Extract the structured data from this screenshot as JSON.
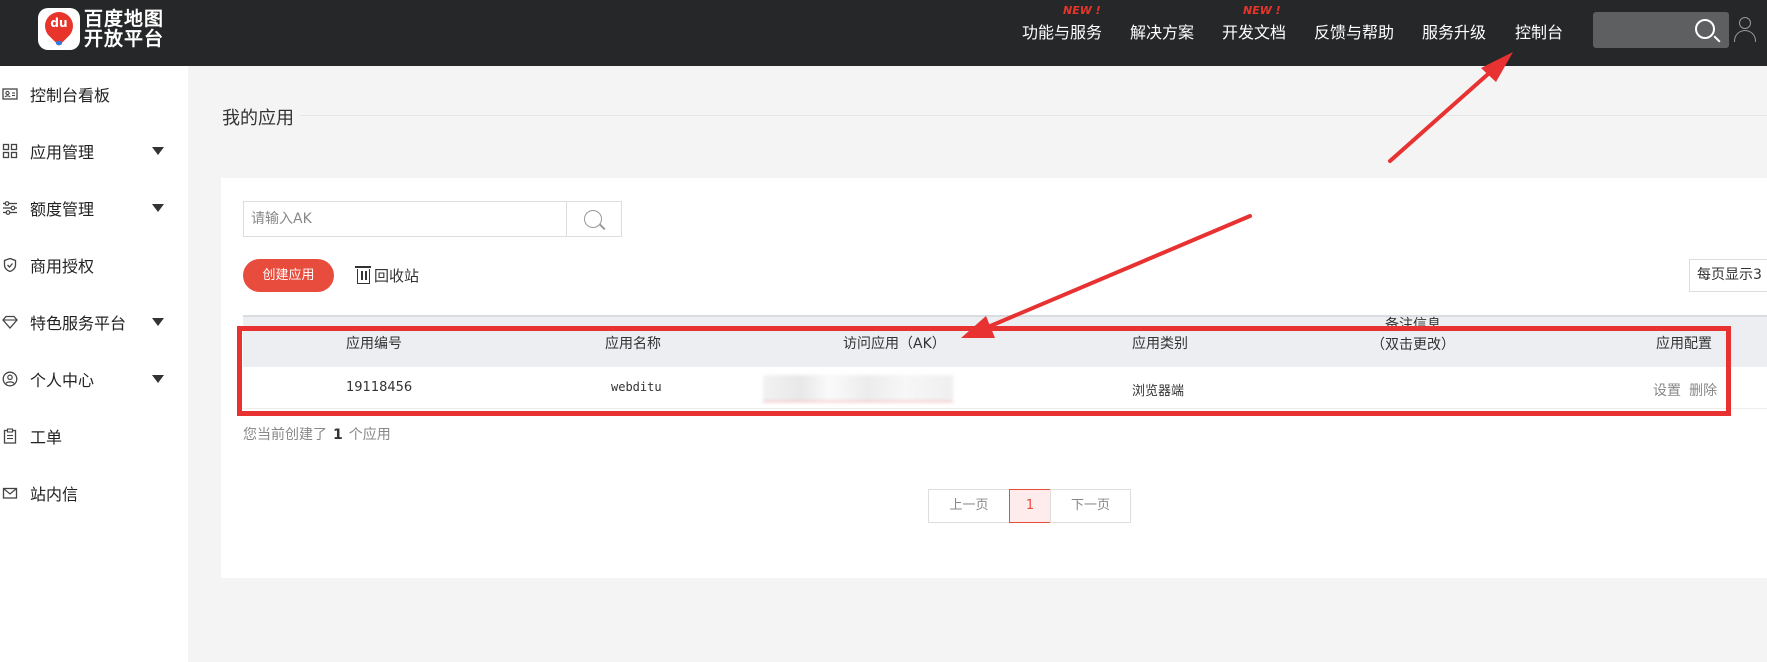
{
  "header": {
    "logo_pin_text": "du",
    "logo_text_line1": "百度地图",
    "logo_text_line2": "开放平台",
    "nav": [
      {
        "label": "功能与服务",
        "badge": "NEW !"
      },
      {
        "label": "解决方案",
        "badge": ""
      },
      {
        "label": "开发文档",
        "badge": "NEW !"
      },
      {
        "label": "反馈与帮助",
        "badge": ""
      },
      {
        "label": "服务升级",
        "badge": ""
      },
      {
        "label": "控制台",
        "badge": ""
      }
    ]
  },
  "sidebar": {
    "items": [
      {
        "label": "控制台看板",
        "icon": "id-card-icon",
        "expandable": false
      },
      {
        "label": "应用管理",
        "icon": "grid-icon",
        "expandable": true
      },
      {
        "label": "额度管理",
        "icon": "sliders-icon",
        "expandable": true
      },
      {
        "label": "商用授权",
        "icon": "shield-icon",
        "expandable": false
      },
      {
        "label": "特色服务平台",
        "icon": "diamond-icon",
        "expandable": true
      },
      {
        "label": "个人中心",
        "icon": "user-circle-icon",
        "expandable": true
      },
      {
        "label": "工单",
        "icon": "clipboard-icon",
        "expandable": false
      },
      {
        "label": "站内信",
        "icon": "mail-icon",
        "expandable": false
      }
    ]
  },
  "main": {
    "page_title": "我的应用",
    "search_placeholder": "请输入AK",
    "create_button": "创建应用",
    "recycle_label": "回收站",
    "page_size_label": "每页显示3",
    "table": {
      "headers": [
        "应用编号",
        "应用名称",
        "访问应用（AK）",
        "应用类别",
        "备注信息",
        "（双击更改）",
        "应用配置"
      ],
      "rows": [
        {
          "id": "19118456",
          "name": "webditu",
          "ak": "",
          "category": "浏览器端",
          "note": "",
          "ops": [
            "设置",
            "删除"
          ]
        }
      ]
    },
    "count_prefix": "您当前创建了",
    "count_value": "1",
    "count_suffix": "个应用",
    "pager": {
      "prev": "上一页",
      "current": "1",
      "next": "下一页"
    }
  },
  "colors": {
    "topbar": "#262728",
    "accent": "#e84c3d",
    "annotation": "#e83232"
  }
}
